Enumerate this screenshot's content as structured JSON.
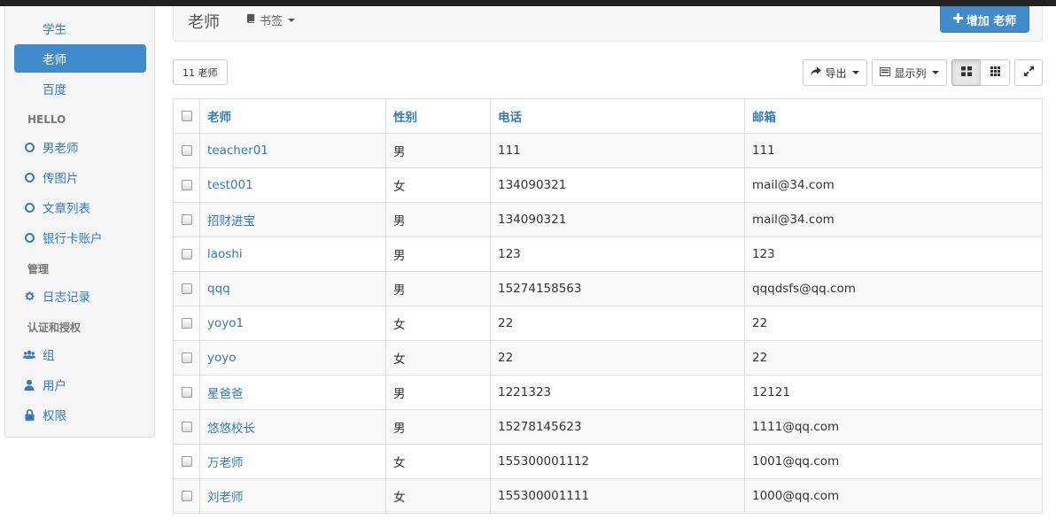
{
  "sidebar": {
    "items_top": [
      {
        "label": "学生",
        "active": false
      },
      {
        "label": "老师",
        "active": true
      },
      {
        "label": "百度",
        "active": false
      }
    ],
    "section_hello": "HELLO",
    "items_hello": [
      {
        "label": "男老师",
        "icon": "circle-icon"
      },
      {
        "label": "传图片",
        "icon": "circle-icon"
      },
      {
        "label": "文章列表",
        "icon": "circle-icon"
      },
      {
        "label": "银行卡账户",
        "icon": "circle-icon"
      }
    ],
    "section_manage": "管理",
    "items_manage": [
      {
        "label": "日志记录",
        "icon": "gear-icon"
      }
    ],
    "section_auth": "认证和授权",
    "items_auth": [
      {
        "label": "组",
        "icon": "users-icon"
      },
      {
        "label": "用户",
        "icon": "user-icon"
      },
      {
        "label": "权限",
        "icon": "lock-icon"
      }
    ]
  },
  "header": {
    "title": "老师",
    "bookmark_label": "书签",
    "add_button_label": "增加 老师"
  },
  "toolbar": {
    "count_label": "11 老师",
    "export_label": "导出",
    "columns_label": "显示列"
  },
  "table": {
    "headers": [
      "老师",
      "性别",
      "电话",
      "邮箱"
    ],
    "rows": [
      [
        "teacher01",
        "男",
        "111",
        "111"
      ],
      [
        "test001",
        "女",
        "134090321",
        "mail@34.com"
      ],
      [
        "招财进宝",
        "男",
        "134090321",
        "mail@34.com"
      ],
      [
        "laoshi",
        "男",
        "123",
        "123"
      ],
      [
        "qqq",
        "男",
        "15274158563",
        "qqqdsfs@qq.com"
      ],
      [
        "yoyo1",
        "女",
        "22",
        "22"
      ],
      [
        "yoyo",
        "女",
        "22",
        "22"
      ],
      [
        "星爸爸",
        "男",
        "1221323",
        "12121"
      ],
      [
        "悠悠校长",
        "男",
        "15278145623",
        "1111@qq.com"
      ],
      [
        "万老师",
        "女",
        "155300001112",
        "1001@qq.com"
      ],
      [
        "刘老师",
        "女",
        "155300001111",
        "1000@qq.com"
      ]
    ]
  },
  "colors": {
    "accent": "#428bca",
    "link": "#337ab7"
  }
}
